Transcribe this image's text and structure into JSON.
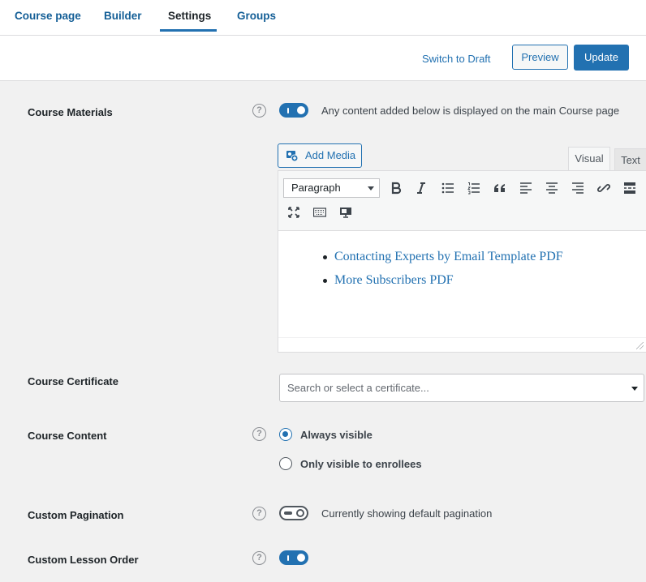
{
  "tabs": [
    {
      "label": "Course page",
      "active": false
    },
    {
      "label": "Builder",
      "active": false
    },
    {
      "label": "Settings",
      "active": true
    },
    {
      "label": "Groups",
      "active": false
    }
  ],
  "actions": {
    "switch_to_draft": "Switch to Draft",
    "preview": "Preview",
    "update": "Update"
  },
  "course_materials": {
    "label": "Course Materials",
    "help_icon": "question-circle-icon",
    "toggle_on": true,
    "hint": "Any content added below is displayed on the main Course page",
    "add_media": "Add Media",
    "editor_tabs": [
      "Visual",
      "Text"
    ],
    "active_editor_tab": "Visual",
    "format_select": "Paragraph",
    "toolbar_icons": [
      "bold-icon",
      "italic-icon",
      "bulleted-list-icon",
      "numbered-list-icon",
      "blockquote-icon",
      "align-left-icon",
      "align-center-icon",
      "align-right-icon",
      "link-icon",
      "read-more-icon",
      "fullscreen-icon",
      "keyboard-icon",
      "monitor-icon"
    ],
    "links": [
      "Contacting Experts by Email Template PDF",
      "More Subscribers PDF"
    ]
  },
  "course_certificate": {
    "label": "Course Certificate",
    "placeholder": "Search or select a certificate..."
  },
  "course_content": {
    "label": "Course Content",
    "help_icon": "question-circle-icon",
    "options": [
      {
        "label": "Always visible",
        "checked": true
      },
      {
        "label": "Only visible to enrollees",
        "checked": false
      }
    ]
  },
  "custom_pagination": {
    "label": "Custom Pagination",
    "help_icon": "question-circle-icon",
    "toggle_on": false,
    "hint": "Currently showing default pagination"
  },
  "custom_lesson_order": {
    "label": "Custom Lesson Order",
    "help_icon": "question-circle-icon",
    "toggle_on": true
  },
  "colors": {
    "accent": "#2271b1",
    "link": "#135e96",
    "background": "#f1f1f1"
  }
}
